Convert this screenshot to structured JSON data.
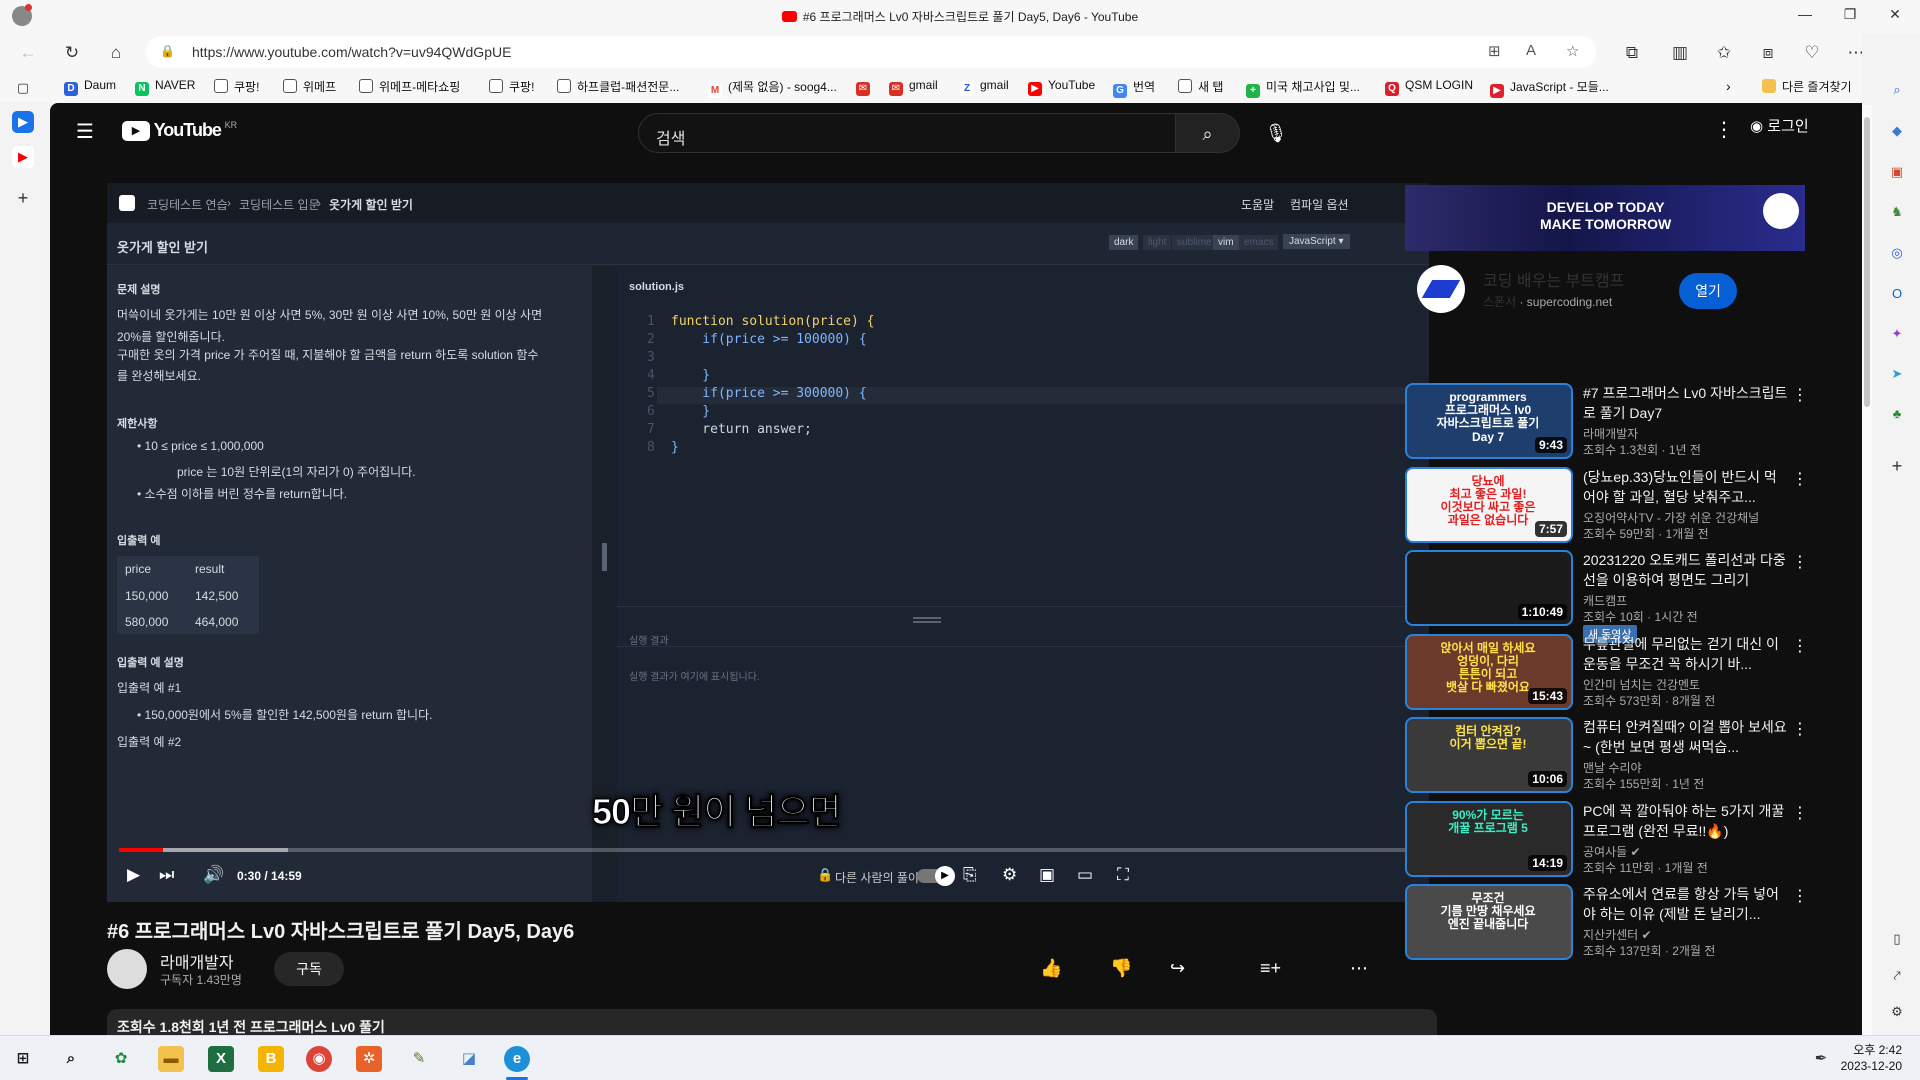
{
  "window": {
    "title": "#6 프로그래머스 Lv0 자바스크립트로 풀기 Day5, Day6 - YouTube"
  },
  "browser": {
    "url": "https://www.youtube.com/watch?v=uv94QWdGpUE",
    "bookmarks": [
      {
        "label": "Daum",
        "color": "#2b60de"
      },
      {
        "label": "NAVER",
        "color": "#03c75a"
      },
      {
        "label": "쿠팡!",
        "color": "#888888"
      },
      {
        "label": "위메프",
        "color": "#888888"
      },
      {
        "label": "위메프-메타쇼핑",
        "color": "#888888"
      },
      {
        "label": "쿠팡!",
        "color": "#888888"
      },
      {
        "label": "하프클럽-패션전문...",
        "color": "#888888"
      },
      {
        "label": "(제목 없음) - soog4...",
        "color": "#ea4335"
      },
      {
        "label": "",
        "color": "#d93025"
      },
      {
        "label": "gmail",
        "color": "#d93025"
      },
      {
        "label": "gmail",
        "color": "#2f4fe0"
      },
      {
        "label": "YouTube",
        "color": "#ff0000"
      },
      {
        "label": "번역",
        "color": "#4285f4"
      },
      {
        "label": "새 탭",
        "color": "#888888"
      },
      {
        "label": "미국 채고사입 및...",
        "color": "#21b24b"
      },
      {
        "label": "QSM LOGIN",
        "color": "#e01e2b"
      },
      {
        "label": "JavaScript - 모들...",
        "color": "#e0202e"
      }
    ],
    "other_favorites": "다른 즐겨찾기"
  },
  "youtube": {
    "logo": "YouTube",
    "region": "KR",
    "search_placeholder": "검색",
    "login": "로그인"
  },
  "player": {
    "breadcrumb": [
      "코딩테스트 연습",
      "코딩테스트 입문",
      "옷가게 할인 받기"
    ],
    "top_links": [
      "도움말",
      "컴파일 옵션"
    ],
    "problem_title": "옷가게 할인 받기",
    "themes": [
      "dark",
      "light",
      "sublime",
      "vim",
      "emacs"
    ],
    "language": "JavaScript",
    "section_desc": "문제 설명",
    "desc_line1": "머쓱이네 옷가게는 10만 원 이상 사면 5%, 30만 원 이상 사면 10%, 50만 원 이상 사면",
    "desc_line2": "20%를 할인해줍니다.",
    "desc_line3": "구매한 옷의 가격  price  가 주어질 때, 지불해야 할 금액을 return 하도록 solution 함수",
    "desc_line4": "를 완성해보세요.",
    "section_limit": "제한사항",
    "limit1": "• 10 ≤  price  ≤ 1,000,000",
    "limit2": "price  는 10원 단위로(1의 자리가 0) 주어집니다.",
    "limit3": "• 소수점 이하를 버린 정수를 return합니다.",
    "section_io": "입출력 예",
    "io_headers": [
      "price",
      "result"
    ],
    "io_rows": [
      [
        "150,000",
        "142,500"
      ],
      [
        "580,000",
        "464,000"
      ]
    ],
    "section_io_desc": "입출력 예 설명",
    "io_ex1": "입출력 예 #1",
    "io_ex1_text": "• 150,000원에서 5%를 할인한 142,500원을 return 합니다.",
    "io_ex2": "입출력 예 #2",
    "filename": "solution.js",
    "code_lines": [
      "function solution(price) {",
      "    if(price >= 100000) {",
      "",
      "    }",
      "    if(price >= 300000) {",
      "    }",
      "    return answer;",
      "}"
    ],
    "run_result_label": "실행 결과",
    "run_result_text": "실행 결과가 여기에 표시됩니다.",
    "subtitle": "50만 원이 넘으면",
    "time": "0:30 / 14:59",
    "progress_fraction": 0.034,
    "bottom_hint": "다른 사람의 풀이"
  },
  "video": {
    "title": "#6 프로그래머스 Lv0 자바스크립트로 풀기 Day5, Day6",
    "channel": "라매개발자",
    "subscribers": "구독자 1.43만명",
    "subscribe": "구독",
    "meta": "조회수 1.8천회  1년 전  프로그래머스 Lv0 풀기"
  },
  "ad": {
    "banner_line1": "DEVELOP TODAY",
    "banner_line2": "MAKE TOMORROW",
    "title": "코딩 배우는 부트캠프",
    "sponsor": "스폰서",
    "domain": "supercoding.net",
    "open": "열기"
  },
  "recommendations": [
    {
      "title": "#7 프로그래머스 Lv0 자바스크립트로 풀기 Day7",
      "channel": "라매개발자",
      "views": "조회수 1.3천회 · 1년 전",
      "duration": "9:43",
      "badge": "",
      "thumb_text": "programmers\n프로그래머스 lv0\n자바스크립트로 풀기\nDay 7"
    },
    {
      "title": "(당뇨ep.33)당뇨인들이 반드시 먹어야 할 과일, 혈당 낮춰주고...",
      "channel": "오징어약사TV - 가장 쉬운 건강채널",
      "views": "조회수 59만회 · 1개월 전",
      "duration": "7:57",
      "badge": "",
      "thumb_text": "당뇨에\n최고 좋은 과일!\n이것보다 싸고 좋은\n과일은 없습니다"
    },
    {
      "title": "20231220 오토캐드 폴리선과 다중선을 이용하여 평면도 그리기",
      "channel": "캐드캠프",
      "views": "조회수 10회 · 1시간 전",
      "duration": "1:10:49",
      "badge": "새 동영상",
      "thumb_text": ""
    },
    {
      "title": "무릎관절에 무리없는 걷기 대신 이 운동을 무조건 꼭 하시기 바...",
      "channel": "인간미 넘치는 건강멘토",
      "views": "조회수 573만회 · 8개월 전",
      "duration": "15:43",
      "badge": "",
      "thumb_text": "앉아서 매일 하세요\n엉덩이, 다리\n튼튼이 되고\n뱃살 다 빠졌어요"
    },
    {
      "title": "컴퓨터 안켜질때? 이걸 뽑아 보세요~ (한번 보면 평생 써먹습...",
      "channel": "맨날 수리야",
      "views": "조회수 155만회 · 1년 전",
      "duration": "10:06",
      "badge": "",
      "thumb_text": "컴터 안켜짐?\n이거 뽑으면 끝!"
    },
    {
      "title": "PC에 꼭 깔아둬야 하는 5가지 개꿀 프로그램 (완전 무료!!🔥)",
      "channel": "공여사들 ✔",
      "views": "조회수 11만회 · 1개월 전",
      "duration": "14:19",
      "badge": "",
      "thumb_text": "90%가 모르는\n개꿀 프로그램 5"
    },
    {
      "title": "주유소에서 연료를 항상 가득 넣어야 하는 이유 (제발 돈 날리기...",
      "channel": "지산카센터 ✔",
      "views": "조회수 137만회 · 2개월 전",
      "duration": "",
      "badge": "",
      "thumb_text": "무조건\n기름 만땅 채우세요\n엔진 끝내줍니다"
    }
  ],
  "taskbar": {
    "time": "오후 2:42",
    "date": "2023-12-20"
  }
}
